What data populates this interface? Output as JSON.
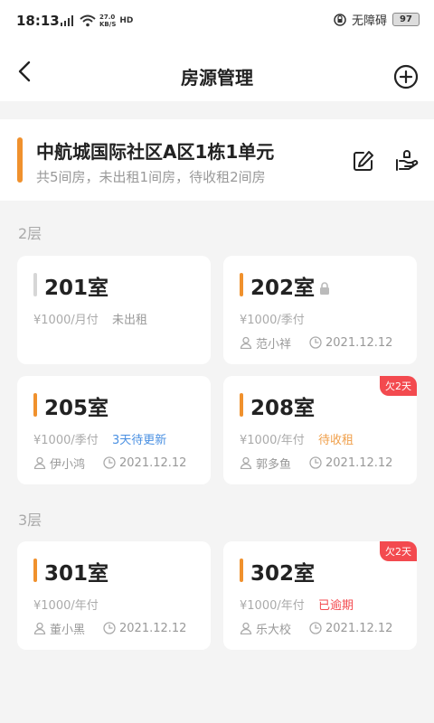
{
  "status_bar": {
    "time": "18:13",
    "net_speed_value": "27.0",
    "net_speed_unit": "KB/S",
    "network_type": "HD",
    "accessibility_label": "无障碍",
    "battery": "97"
  },
  "nav": {
    "title": "房源管理",
    "back_icon": "back-icon",
    "add_icon": "plus-circle-icon"
  },
  "building": {
    "name": "中航城国际社区A区1栋1单元",
    "summary": "共5间房，未出租1间房，待收租2间房",
    "accent_color": "#f0912d"
  },
  "floors": [
    {
      "label": "2层",
      "rooms": [
        {
          "name": "201室",
          "price": "¥1000/月付",
          "status": "未出租",
          "tenant": "",
          "date": "",
          "badge": ""
        },
        {
          "name": "202室",
          "price": "¥1000/季付",
          "status": "",
          "tenant": "范小祥",
          "date": "2021.12.12",
          "badge": ""
        },
        {
          "name": "205室",
          "price": "¥1000/季付",
          "status": "3天待更新",
          "tenant": "伊小鸿",
          "date": "2021.12.12",
          "badge": ""
        },
        {
          "name": "208室",
          "price": "¥1000/年付",
          "status": "待收租",
          "tenant": "郭多鱼",
          "date": "2021.12.12",
          "badge": "欠2天"
        }
      ]
    },
    {
      "label": "3层",
      "rooms": [
        {
          "name": "301室",
          "price": "¥1000/年付",
          "status": "",
          "tenant": "董小黑",
          "date": "2021.12.12",
          "badge": ""
        },
        {
          "name": "302室",
          "price": "¥1000/年付",
          "status": "已逾期",
          "tenant": "乐大校",
          "date": "2021.12.12",
          "badge": "欠2天"
        }
      ]
    }
  ],
  "colors": {
    "vacant_status": "#999999",
    "update_status": "#4a90e2",
    "collect_status": "#f0a04b",
    "overdue_status": "#f34a4f",
    "badge_bg": "#f34a4f"
  }
}
